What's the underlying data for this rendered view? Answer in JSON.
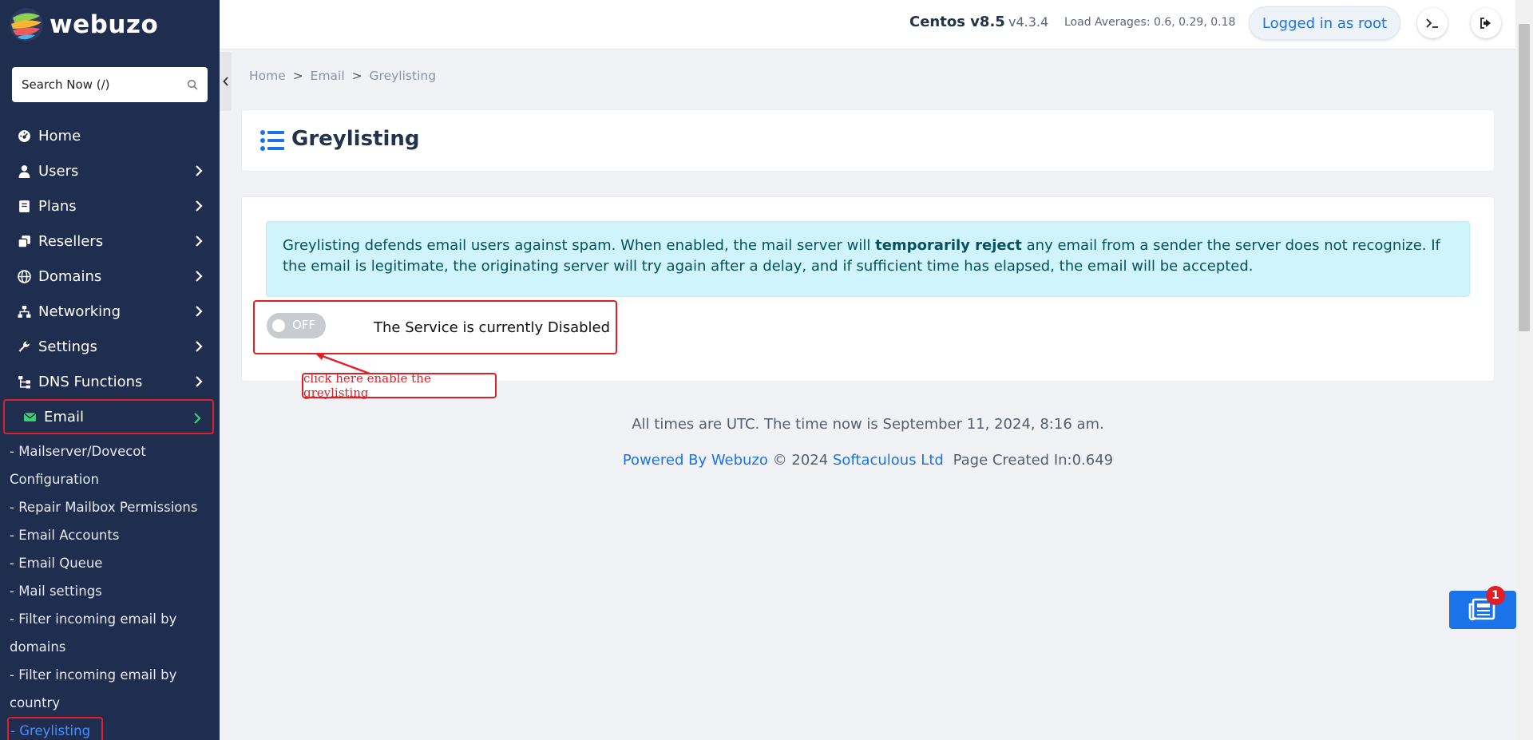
{
  "app": {
    "name": "webuzo"
  },
  "search": {
    "placeholder": "Search Now (/)"
  },
  "topbar": {
    "os": "Centos v8.5",
    "version": "v4.3.4",
    "load": "Load Averages: 0.6, 0.29, 0.18",
    "login_label": "Logged in as root"
  },
  "sidebar": {
    "items": [
      {
        "label": "Home",
        "icon": "dashboard-icon"
      },
      {
        "label": "Users",
        "icon": "user-icon"
      },
      {
        "label": "Plans",
        "icon": "book-icon"
      },
      {
        "label": "Resellers",
        "icon": "copy-icon"
      },
      {
        "label": "Domains",
        "icon": "globe-icon"
      },
      {
        "label": "Networking",
        "icon": "network-icon"
      },
      {
        "label": "Settings",
        "icon": "wrench-icon"
      },
      {
        "label": "DNS Functions",
        "icon": "sitemap-icon"
      },
      {
        "label": "Email",
        "icon": "envelope-icon"
      }
    ],
    "email_sub": [
      "- Mailserver/Dovecot",
      "Configuration",
      "- Repair Mailbox Permissions",
      "- Email Accounts",
      "- Email Queue",
      "- Mail settings",
      "- Filter incoming email by",
      "domains",
      "- Filter incoming email by",
      "country",
      "- Greylisting"
    ]
  },
  "breadcrumb": {
    "home": "Home",
    "sep": ">",
    "email": "Email",
    "current": "Greylisting"
  },
  "page": {
    "title": "Greylisting"
  },
  "info": {
    "text_before": "Greylisting defends email users against spam. When enabled, the mail server will ",
    "bold": "temporarily reject",
    "text_after": " any email from a sender the server does not recognize. If the email is legitimate, the originating server will try again after a delay, and if sufficient time has elapsed, the email will be accepted."
  },
  "toggle": {
    "state_label": "OFF",
    "status_text": "The Service is currently Disabled"
  },
  "annotation": {
    "label": "click here enable the greylisting",
    "color": "#e01f26"
  },
  "footer": {
    "time": "All times are UTC. The time now is September 11, 2024, 8:16 am.",
    "powered": "Powered By Webuzo",
    "copyright": "© 2024",
    "company": "Softaculous Ltd",
    "created": "Page Created In:0.649"
  },
  "news": {
    "badge": "1"
  },
  "colors": {
    "sidebar": "#1f2d4f",
    "accent": "#1a73e8",
    "highlight": "#e01f26"
  }
}
